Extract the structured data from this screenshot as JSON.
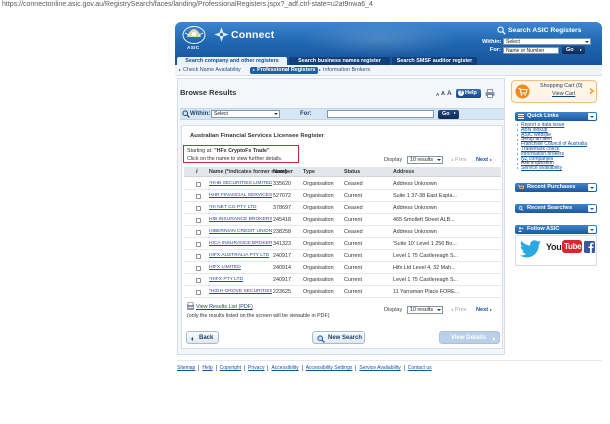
{
  "browser": {
    "url": "https://connectonline.asic.gov.au/RegistrySearch/faces/landing/ProfessionalRegisters.jspx?_adf.ctrl-state=u2at9nwa6_4"
  },
  "header": {
    "asic_label": "ASIC",
    "brand": "Connect",
    "search_title": "Search ASIC Registers",
    "within_label": "Within:",
    "within_value": "Select",
    "for_label": "For:",
    "for_placeholder": "Name or Number",
    "go_label": "Go",
    "colors": {
      "band": "#2168b3",
      "band_dark": "#123f79"
    }
  },
  "tabs": [
    {
      "label": "Search company and other registers",
      "active": true
    },
    {
      "label": "Search business names register",
      "active": false
    },
    {
      "label": "Search SMSF auditor register",
      "active": false
    }
  ],
  "subtabs": [
    {
      "label": "Check Name Availability",
      "active": false
    },
    {
      "label": "Professional Registers",
      "active": true
    },
    {
      "label": "Information Brokers",
      "active": false
    }
  ],
  "main": {
    "title": "Browse Results",
    "text_size": [
      "A",
      "A",
      "A"
    ],
    "help_label": "Help",
    "help_icon": "?",
    "search": {
      "within_label": "Within:",
      "within_value": "Select",
      "for_label": "For:",
      "for_value": "",
      "go_label": "Go"
    },
    "register_title": "Australian Financial Services Licensee Register",
    "starting_label": "Starting at:",
    "starting_value": "\"HFx CryptoFx Trade\"",
    "click_hint": "Click on the name to view further details.",
    "display_label": "Display",
    "display_value": "10 results",
    "prev_label": "Prev",
    "next_label": "Next",
    "table": {
      "columns": {
        "info": "i",
        "name": "Name (*indicates former name)",
        "number": "Number",
        "type": "Type",
        "status": "Status",
        "address": "Address"
      },
      "rows": [
        {
          "name": "*HHB SECURITIES LIMITED",
          "number": "335620",
          "type": "Organisation",
          "status": "Ceased",
          "address": "Address Unknown"
        },
        {
          "name": "HHR FINANCIAL SERVICES PTY LTD",
          "number": "527072",
          "type": "Organisation",
          "status": "Current",
          "address": "Suite 1 37-38 East Espla..."
        },
        {
          "name": "*HI NET CO PTY LTD",
          "number": "378697",
          "type": "Organisation",
          "status": "Ceased",
          "address": "Address Unknown"
        },
        {
          "name": "HIB INSURANCE BROKERS PTY. LT",
          "number": "245418",
          "type": "Organisation",
          "status": "Current",
          "address": "465 Smollett Street ALB..."
        },
        {
          "name": "HIBERNIAN CREDIT UNION LIMIT",
          "number": "238258",
          "type": "Organisation",
          "status": "Ceased",
          "address": "Address Unknown"
        },
        {
          "name": "HICA INSURANCE BROKERS PTY L",
          "number": "341323",
          "type": "Organisation",
          "status": "Current",
          "address": "'Suite 10' Level 1 256 Bo..."
        },
        {
          "name": "HIFX AUSTRALIA PTY LTD",
          "number": "240917",
          "type": "Organisation",
          "status": "Current",
          "address": "Level 1 75 Castlereagh S..."
        },
        {
          "name": "HIFX LIMITED",
          "number": "240914",
          "type": "Organisation",
          "status": "Current",
          "address": "Hifx Ltd Level 4, 32 Mah..."
        },
        {
          "name": "*HIFX PTY LTD",
          "number": "240917",
          "type": "Organisation",
          "status": "Current",
          "address": "Level 1 75 Castlereagh S..."
        },
        {
          "name": "*HIGH GROVE SECURITIES PTY. L",
          "number": "223625",
          "type": "Organisation",
          "status": "Current",
          "address": "11 Yarraman Place FORE..."
        }
      ]
    },
    "pdf_link": "View Results List (PDF)",
    "pdf_note": "(only the results listed on the screen will be viewable in PDF)",
    "back_label": "Back",
    "new_search_label": "New Search",
    "view_details_label": "View Details",
    "highlight_color": "#d9262c"
  },
  "sidebar": {
    "cart": {
      "title": "Shopping Cart (0)",
      "view": "View Cart"
    },
    "quick_links": {
      "title": "Quick Links",
      "items": [
        "Report a data issue",
        "ABN lookup",
        "ASIC website",
        "Setup an alert",
        "Franchise Council of Australia",
        "Trademark check",
        "Information brokers",
        "NZ companies",
        "Ask a question",
        "Service availability"
      ]
    },
    "recent_purchases": "Recent Purchases",
    "recent_searches": "Recent Searches",
    "follow": {
      "title": "Follow ASIC",
      "youtube_you": "You",
      "youtube_tube": "Tube"
    }
  },
  "footer": {
    "links": [
      "Sitemap",
      "Help",
      "Copyright",
      "Privacy",
      "Accessibility",
      "Accessibility Settings",
      "Service Availability",
      "Contact us"
    ]
  }
}
